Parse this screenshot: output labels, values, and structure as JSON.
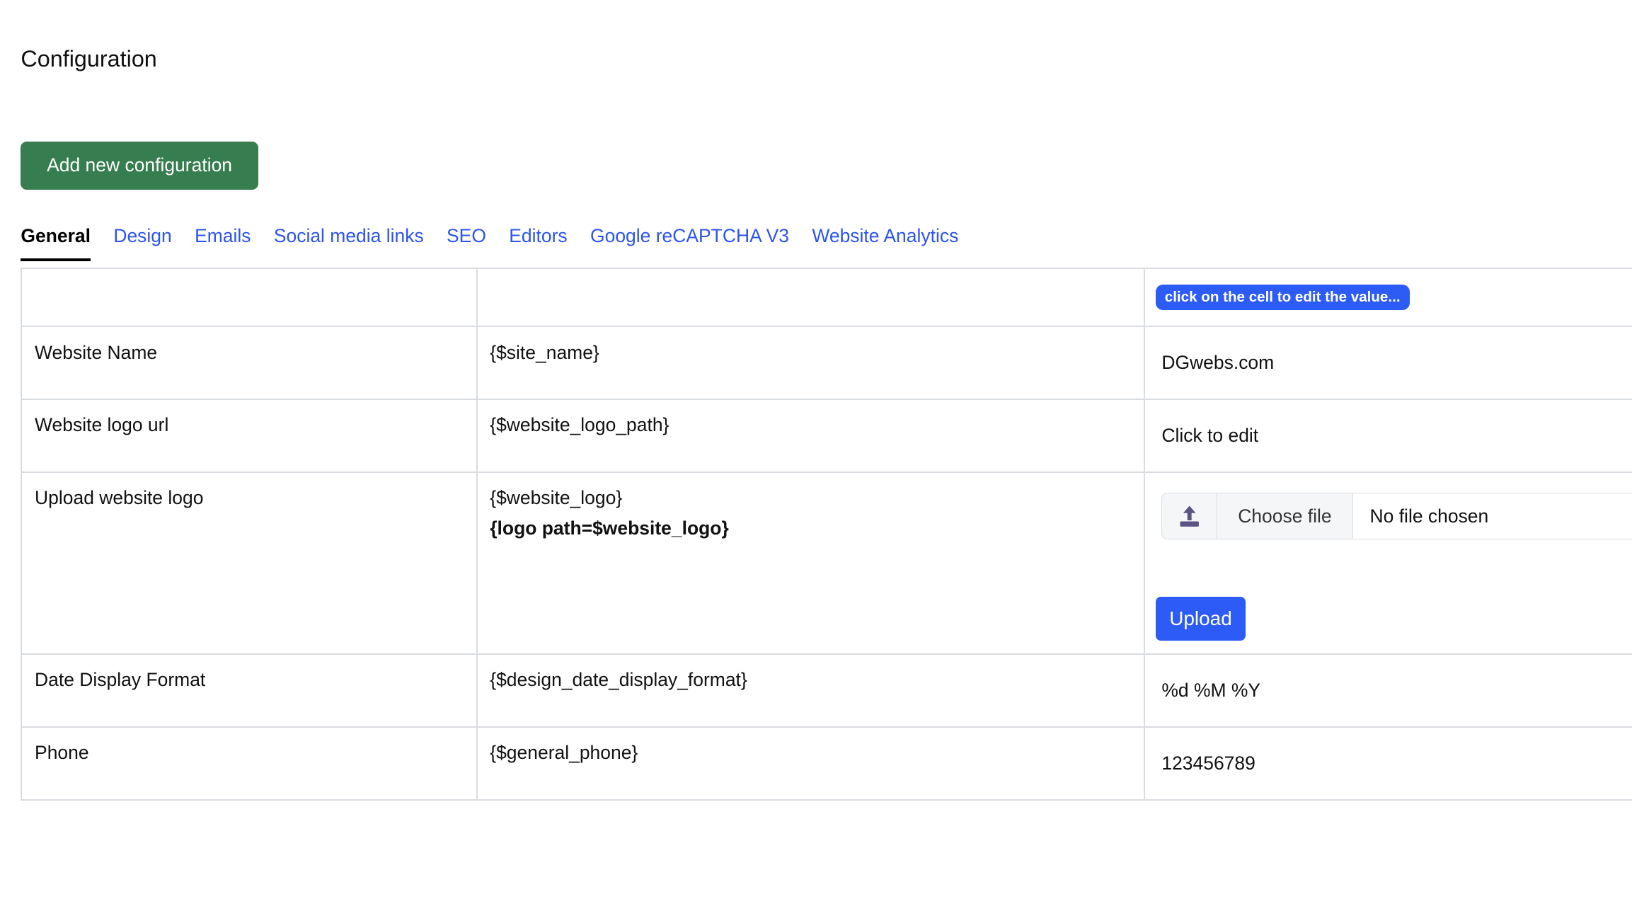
{
  "page": {
    "title": "Configuration"
  },
  "toolbar": {
    "add_label": "Add new configuration"
  },
  "tabs": [
    {
      "label": "General",
      "active": true
    },
    {
      "label": "Design"
    },
    {
      "label": "Emails"
    },
    {
      "label": "Social media links"
    },
    {
      "label": "SEO"
    },
    {
      "label": "Editors"
    },
    {
      "label": "Google reCAPTCHA V3"
    },
    {
      "label": "Website Analytics"
    }
  ],
  "table": {
    "hint": "click on the cell to edit the value...",
    "rows": [
      {
        "name": "Website Name",
        "var": "{$site_name}",
        "value": "DGwebs.com"
      },
      {
        "name": "Website logo url",
        "var": "{$website_logo_path}",
        "value": "Click to edit"
      },
      {
        "name": "Upload website logo",
        "var": "{$website_logo}",
        "var2": "{logo path=$website_logo}",
        "choose_label": "Choose file",
        "file_status": "No file chosen",
        "upload_label": "Upload",
        "icon": "upload-icon"
      },
      {
        "name": "Date Display Format",
        "var": "{$design_date_display_format}",
        "value": "%d %M %Y"
      },
      {
        "name": "Phone",
        "var": "{$general_phone}",
        "value": "123456789"
      }
    ]
  },
  "colors": {
    "primary": "#2c5bf6",
    "success": "#367d4f",
    "link": "#2c54ee",
    "border": "#d9dce1"
  }
}
